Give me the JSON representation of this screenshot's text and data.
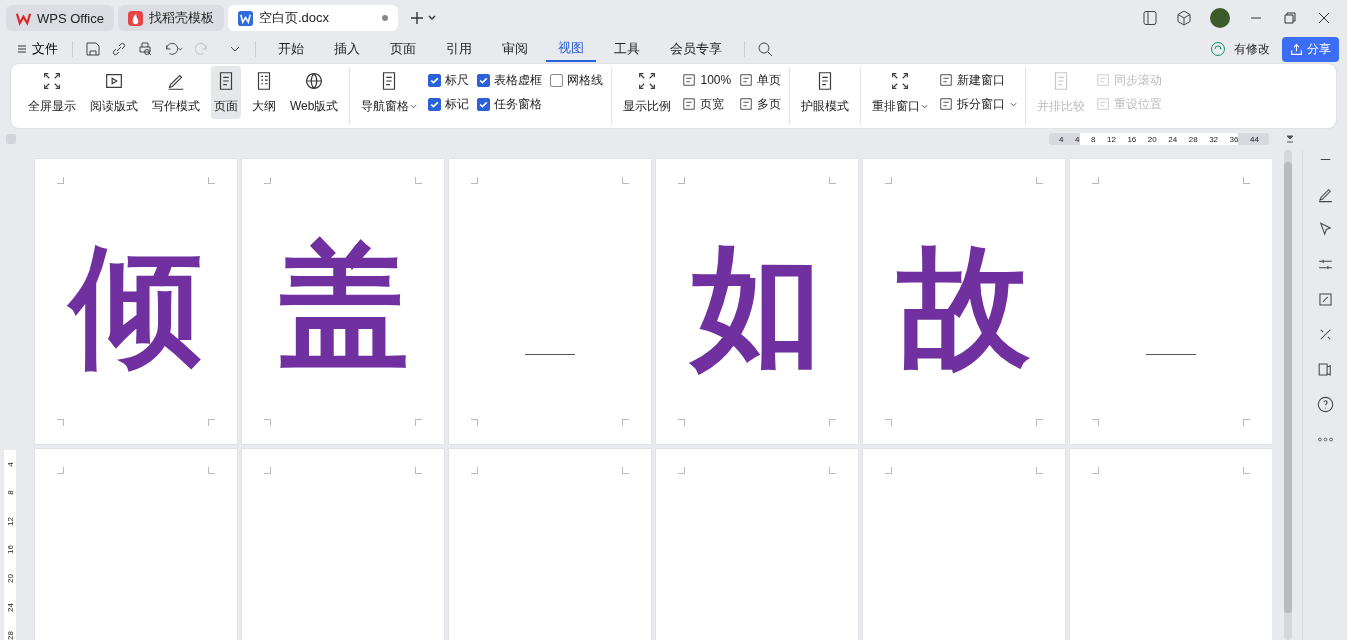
{
  "tabs": [
    {
      "kind": "wps",
      "label": "WPS Office",
      "selected": false
    },
    {
      "kind": "template",
      "label": "找稻壳模板",
      "selected": false
    },
    {
      "kind": "doc",
      "label": "空白页.docx",
      "selected": true
    }
  ],
  "menu": {
    "file": "文件",
    "ribbon_tabs": [
      {
        "label": "开始",
        "selected": false
      },
      {
        "label": "插入",
        "selected": false
      },
      {
        "label": "页面",
        "selected": false
      },
      {
        "label": "引用",
        "selected": false
      },
      {
        "label": "审阅",
        "selected": false
      },
      {
        "label": "视图",
        "selected": true
      },
      {
        "label": "工具",
        "selected": false
      },
      {
        "label": "会员专享",
        "selected": false
      }
    ],
    "save_status": "有修改",
    "share": "分享"
  },
  "ribbon": [
    {
      "disabled": false,
      "items": [
        {
          "kind": "big",
          "label": "全屏显示",
          "selected": false,
          "dropdown": false
        },
        {
          "kind": "big",
          "label": "阅读版式",
          "selected": false,
          "dropdown": false
        },
        {
          "kind": "big",
          "label": "写作模式",
          "selected": false,
          "dropdown": false
        },
        {
          "kind": "big",
          "label": "页面",
          "selected": true,
          "dropdown": false
        },
        {
          "kind": "big",
          "label": "大纲",
          "selected": false,
          "dropdown": false
        },
        {
          "kind": "big",
          "label": "Web版式",
          "selected": false,
          "dropdown": false
        }
      ]
    },
    {
      "disabled": false,
      "items": [
        {
          "kind": "big",
          "label": "导航窗格",
          "selected": false,
          "dropdown": true
        },
        {
          "kind": "check",
          "label": "标尺",
          "checked": true
        },
        {
          "kind": "check",
          "label": "标记",
          "checked": true
        },
        {
          "kind": "check",
          "label": "表格虚框",
          "checked": true
        },
        {
          "kind": "check",
          "label": "任务窗格",
          "checked": true
        },
        {
          "kind": "check",
          "label": "网格线",
          "checked": false
        }
      ]
    },
    {
      "disabled": false,
      "items": [
        {
          "kind": "big",
          "label": "显示比例",
          "selected": false,
          "dropdown": false
        },
        {
          "kind": "small",
          "label": "100%",
          "dropdown": false
        },
        {
          "kind": "small",
          "label": "页宽",
          "dropdown": false
        },
        {
          "kind": "small",
          "label": "单页",
          "dropdown": false
        },
        {
          "kind": "small",
          "label": "多页",
          "dropdown": false
        }
      ]
    },
    {
      "disabled": false,
      "items": [
        {
          "kind": "big",
          "label": "护眼模式",
          "selected": false,
          "dropdown": false
        }
      ]
    },
    {
      "disabled": false,
      "items": [
        {
          "kind": "big",
          "label": "重排窗口",
          "selected": false,
          "dropdown": true
        },
        {
          "kind": "small",
          "label": "新建窗口",
          "dropdown": false
        },
        {
          "kind": "small",
          "label": "拆分窗口",
          "dropdown": true
        }
      ]
    },
    {
      "disabled": true,
      "items": [
        {
          "kind": "big",
          "label": "并排比较",
          "selected": false,
          "dropdown": false
        },
        {
          "kind": "small",
          "label": "同步滚动",
          "dropdown": false
        },
        {
          "kind": "small",
          "label": "重设位置",
          "dropdown": false
        }
      ]
    }
  ],
  "ruler": {
    "horizontal": [
      "4",
      "4",
      "8",
      "12",
      "16",
      "20",
      "24",
      "28",
      "32",
      "36",
      "44"
    ],
    "vertical": [
      "4",
      "8",
      "12",
      "16",
      "20",
      "24",
      "28"
    ]
  },
  "pages": [
    {
      "kind": "character",
      "text": "倾"
    },
    {
      "kind": "character",
      "text": "盖"
    },
    {
      "kind": "blank"
    },
    {
      "kind": "character",
      "text": "如"
    },
    {
      "kind": "character",
      "text": "故"
    },
    {
      "kind": "blank"
    },
    {
      "kind": "cut"
    },
    {
      "kind": "cut"
    },
    {
      "kind": "cut"
    },
    {
      "kind": "cut"
    },
    {
      "kind": "cut"
    },
    {
      "kind": "cut"
    }
  ]
}
